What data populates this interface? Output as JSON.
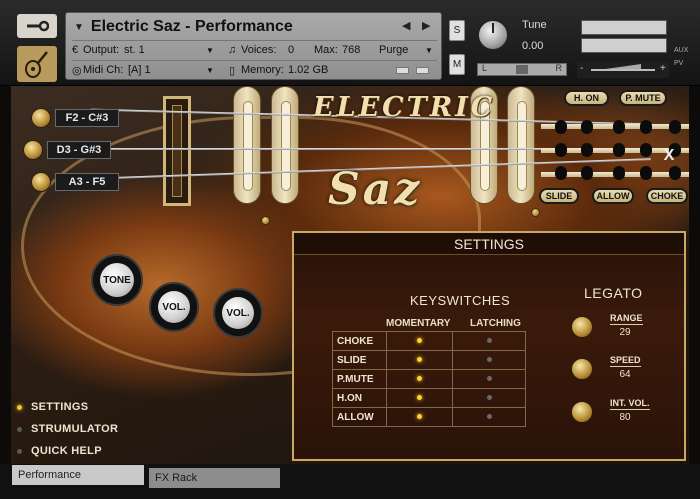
{
  "header": {
    "instrument_title": "Electric Saz - Performance",
    "output_label": "Output:",
    "output_value": "st. 1",
    "voices_label": "Voices:",
    "voices_value": "0",
    "max_label": "Max:",
    "max_value": "768",
    "purge_label": "Purge",
    "midi_label": "Midi Ch:",
    "midi_value": "[A]  1",
    "memory_label": "Memory:",
    "memory_value": "1.02 GB",
    "solo_label": "S",
    "mute_label": "M",
    "tune_label": "Tune",
    "tune_value": "0.00",
    "pan_left": "L",
    "pan_right": "R",
    "aux_label": "AUX",
    "pv_label": "PV",
    "vol_minus": "-",
    "vol_plus": "+"
  },
  "instrument": {
    "brand_top": "ELECTRIC",
    "brand_bottom": "Saz",
    "tunings": [
      "F2 - C#3",
      "D3 - G#3",
      "A3 - F5"
    ],
    "articulations_top": [
      "H. ON",
      "P. MUTE"
    ],
    "articulations_bottom": [
      "SLIDE",
      "ALLOW",
      "CHOKE"
    ],
    "knobs": [
      "TONE",
      "VOL.",
      "VOL."
    ]
  },
  "menu": {
    "items": [
      {
        "label": "SETTINGS",
        "active": true
      },
      {
        "label": "STRUMULATOR",
        "active": false
      },
      {
        "label": "QUICK HELP",
        "active": false
      }
    ]
  },
  "settings": {
    "title": "SETTINGS",
    "close_label": "X",
    "keyswitches_title": "KEYSWITCHES",
    "col_momentary": "MOMENTARY",
    "col_latching": "LATCHING",
    "rows": [
      {
        "name": "CHOKE",
        "momentary": true,
        "latching": false
      },
      {
        "name": "SLIDE",
        "momentary": true,
        "latching": false
      },
      {
        "name": "P.MUTE",
        "momentary": true,
        "latching": false
      },
      {
        "name": "H.ON",
        "momentary": true,
        "latching": false
      },
      {
        "name": "ALLOW",
        "momentary": true,
        "latching": false
      }
    ],
    "legato_title": "LEGATO",
    "range_label": "RANGE",
    "range_value": "29",
    "speed_label": "SPEED",
    "speed_value": "64",
    "intvol_label": "INT. VOL.",
    "intvol_value": "80"
  },
  "tabs": {
    "performance": "Performance",
    "fx_rack": "FX Rack"
  },
  "colors": {
    "accent_led": "#ffd42a",
    "panel_border": "#c8a862"
  }
}
